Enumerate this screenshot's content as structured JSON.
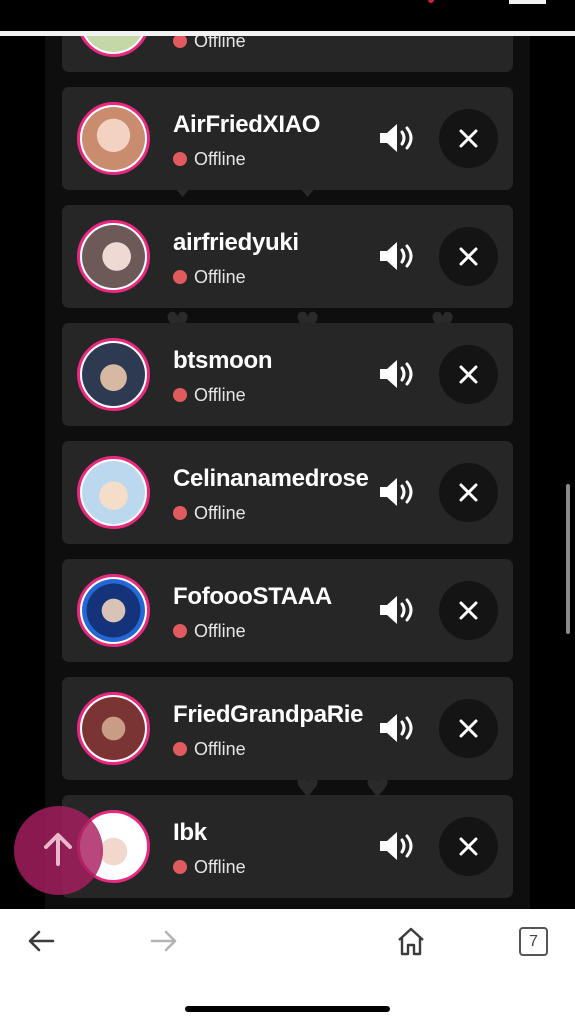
{
  "friends": [
    {
      "name": "",
      "status": "Offline",
      "avatar_color": "#c4d7a7"
    },
    {
      "name": "AirFriedXIAO",
      "status": "Offline",
      "avatar_color": "#d9a48f"
    },
    {
      "name": "airfriedyuki",
      "status": "Offline",
      "avatar_color": "#a3908d"
    },
    {
      "name": "btsmoon",
      "status": "Offline",
      "avatar_color": "#3f5475"
    },
    {
      "name": "Celinanamedrose",
      "status": "Offline",
      "avatar_color": "#d2e4f1"
    },
    {
      "name": "FofoooSTAAA",
      "status": "Offline",
      "avatar_color": "#1c4fa3"
    },
    {
      "name": "FriedGrandpaRie",
      "status": "Offline",
      "avatar_color": "#8c4a4a"
    },
    {
      "name": "Ibk",
      "status": "Offline",
      "avatar_color": "#e8d8d8"
    }
  ],
  "bottom_nav": {
    "tab_count": "7"
  },
  "icons": {
    "speaker": "volume-icon",
    "remove": "close-icon",
    "scroll_top": "arrow-up-icon",
    "back": "arrow-left-icon",
    "forward": "arrow-right-icon",
    "home": "home-icon"
  },
  "colors": {
    "accent": "#e8297f",
    "offline": "#e05a5f",
    "card": "#262626"
  }
}
